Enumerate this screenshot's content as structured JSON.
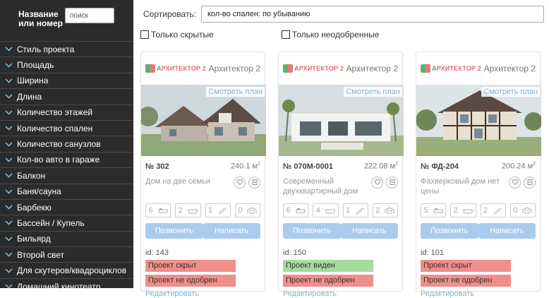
{
  "sidebar": {
    "title": "Название или номер",
    "search_placeholder": "поиск",
    "items": [
      {
        "label": "Стиль проекта"
      },
      {
        "label": "Площадь"
      },
      {
        "label": "Ширина"
      },
      {
        "label": "Длина"
      },
      {
        "label": "Количество этажей"
      },
      {
        "label": "Количество спален"
      },
      {
        "label": "Количество санузлов"
      },
      {
        "label": "Кол-во авто в гараже"
      },
      {
        "label": "Балкон"
      },
      {
        "label": "Баня/сауна"
      },
      {
        "label": "Барбекю"
      },
      {
        "label": "Бассейн / Купель"
      },
      {
        "label": "Бильярд"
      },
      {
        "label": "Второй свет"
      },
      {
        "label": "Для скутеров/квадроциклов"
      },
      {
        "label": "Домашний кинотеатр"
      }
    ]
  },
  "sort": {
    "label": "Сортировать:",
    "value": "кол-во спален: по убыванию"
  },
  "filters": {
    "hidden_only": "Только скрытые",
    "unapproved_only": "Только неодобренные"
  },
  "cards": [
    {
      "logo_text_a": "А",
      "logo_text_b": "РХИТЕКТОР 2",
      "architect": "Архитектор 2",
      "view_plan": "Смотреть план",
      "number": "№ 302",
      "area": "240.1 м",
      "area_unit_sup": "2",
      "description": "Дом на две семьи",
      "bedrooms": "6",
      "bathrooms": "2",
      "floors": "1",
      "garage": "0",
      "call_label": "Позвонить",
      "write_label": "Написать",
      "id": "id: 143",
      "status_visibility": "Проект скрыт",
      "status_visibility_color": "#f08d8d",
      "status_approval": "Проект не одобрен",
      "edit_label": "Редактировать"
    },
    {
      "logo_text_a": "А",
      "logo_text_b": "РХИТЕКТОР 2",
      "architect": "Архитектор 2",
      "view_plan": "Смотреть план",
      "number": "№ 070М-0001",
      "area": "222.08 м",
      "area_unit_sup": "2",
      "description": "Современный двухквартирный дом",
      "bedrooms": "6",
      "bathrooms": "4",
      "floors": "1",
      "garage": "2",
      "call_label": "Позвонить",
      "write_label": "Написать",
      "id": "id: 150",
      "status_visibility": "Проект виден",
      "status_visibility_color": "#a5dc9b",
      "status_approval": "Проект не одобрен",
      "edit_label": "Редактировать"
    },
    {
      "logo_text_a": "А",
      "logo_text_b": "РХИТЕКТОР 2",
      "architect": "Архитектор 2",
      "view_plan": "Смотреть план",
      "number": "№ ФД-204",
      "area": "200.24 м",
      "area_unit_sup": "2",
      "description": "Фахверковый дом нет цены",
      "bedrooms": "5",
      "bathrooms": "2",
      "floors": "2",
      "garage": "0",
      "call_label": "Позвонить",
      "write_label": "Написать",
      "id": "id: 101",
      "status_visibility": "Проект скрыт",
      "status_visibility_color": "#f08d8d",
      "status_approval": "Проект не одобрен",
      "edit_label": "Редактировать"
    }
  ],
  "colors": {
    "sidebar_bg": "#2b2b2b",
    "button_bg": "#a9ccee",
    "badge_red": "#f08d8d",
    "badge_green": "#a5dc9b",
    "link": "#7fb4d8"
  }
}
